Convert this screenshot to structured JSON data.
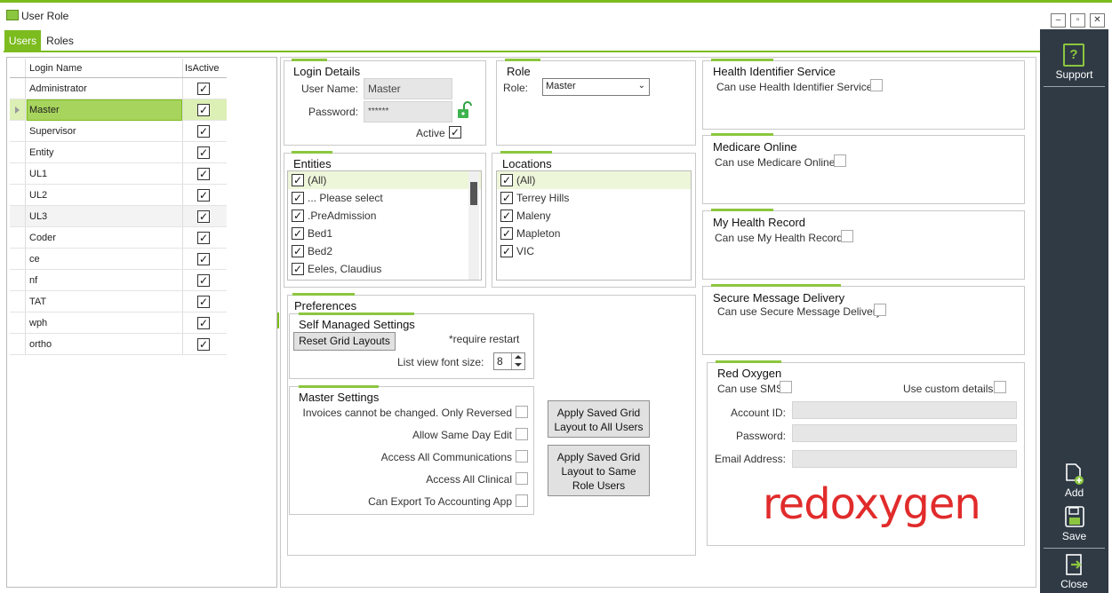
{
  "window": {
    "title": "User Role",
    "minimize": "–",
    "maximize": "▫",
    "close": "✕"
  },
  "tabs": [
    {
      "label": "Users"
    },
    {
      "label": "Roles"
    }
  ],
  "users_grid": {
    "col_login": "Login Name",
    "col_active": "IsActive",
    "rows": [
      {
        "login": "Administrator",
        "active": "✓"
      },
      {
        "login": "Master",
        "active": "✓"
      },
      {
        "login": "Supervisor",
        "active": "✓"
      },
      {
        "login": "Entity",
        "active": "✓"
      },
      {
        "login": "UL1",
        "active": "✓"
      },
      {
        "login": "UL2",
        "active": "✓"
      },
      {
        "login": "UL3",
        "active": "✓"
      },
      {
        "login": "Coder",
        "active": "✓"
      },
      {
        "login": "ce",
        "active": "✓"
      },
      {
        "login": "nf",
        "active": "✓"
      },
      {
        "login": "TAT",
        "active": "✓"
      },
      {
        "login": "wph",
        "active": "✓"
      },
      {
        "login": "ortho",
        "active": "✓"
      }
    ]
  },
  "login_details": {
    "title": "Login Details",
    "username_label": "User Name:",
    "username_value": "Master",
    "password_label": "Password:",
    "password_value": "******",
    "active_label": "Active",
    "active_check": "✓"
  },
  "role": {
    "title": "Role",
    "label": "Role:",
    "value": "Master",
    "caret": "⌄"
  },
  "entities": {
    "title": "Entities",
    "items": [
      {
        "label": "(All)",
        "check": "✓"
      },
      {
        "label": "... Please select",
        "check": "✓"
      },
      {
        "label": ".PreAdmission",
        "check": "✓"
      },
      {
        "label": "Bed1",
        "check": "✓"
      },
      {
        "label": "Bed2",
        "check": "✓"
      },
      {
        "label": "Eeles, Claudius",
        "check": "✓"
      }
    ]
  },
  "locations": {
    "title": "Locations",
    "items": [
      {
        "label": "(All)",
        "check": "✓"
      },
      {
        "label": "Terrey Hills",
        "check": "✓"
      },
      {
        "label": "Maleny",
        "check": "✓"
      },
      {
        "label": "Mapleton",
        "check": "✓"
      },
      {
        "label": "VIC",
        "check": "✓"
      }
    ]
  },
  "preferences": {
    "title": "Preferences",
    "self_managed": {
      "title": "Self Managed Settings",
      "reset_button": "Reset Grid Layouts",
      "note": "*require restart",
      "font_label": "List view font size:",
      "font_value": "8"
    },
    "master_settings": {
      "title": "Master Settings",
      "items": [
        {
          "label": "Invoices cannot be changed. Only Reversed"
        },
        {
          "label": "Allow Same Day Edit"
        },
        {
          "label": "Access All Communications"
        },
        {
          "label": "Access All Clinical"
        },
        {
          "label": "Can Export To Accounting App"
        }
      ]
    },
    "apply_all_line1": "Apply Saved Grid",
    "apply_all_line2": "Layout to All Users",
    "apply_same_line1": "Apply Saved Grid",
    "apply_same_line2": "Layout to Same",
    "apply_same_line3": "Role Users"
  },
  "services": {
    "hi": {
      "title": "Health Identifier Service",
      "label": "Can use Health Identifier Service"
    },
    "medicare": {
      "title": "Medicare Online",
      "label": "Can use Medicare Online"
    },
    "mhr": {
      "title": "My Health Record",
      "label": "Can use My Health Record"
    },
    "smd": {
      "title": "Secure Message Delivery",
      "label": "Can use Secure Message Delivery"
    }
  },
  "red_oxygen": {
    "title": "Red Oxygen",
    "can_use_sms": "Can use SMS",
    "use_custom": "Use custom details",
    "account_label": "Account ID:",
    "password_label": "Password:",
    "email_label": "Email Address:",
    "logo_text": "redoxygen"
  },
  "sidebar": {
    "support": "Support",
    "add": "Add",
    "save": "Save",
    "close": "Close"
  },
  "colors": {
    "accent": "#7cbc1e",
    "sidebar": "#2f3a45",
    "logo": "#e12b2b"
  }
}
